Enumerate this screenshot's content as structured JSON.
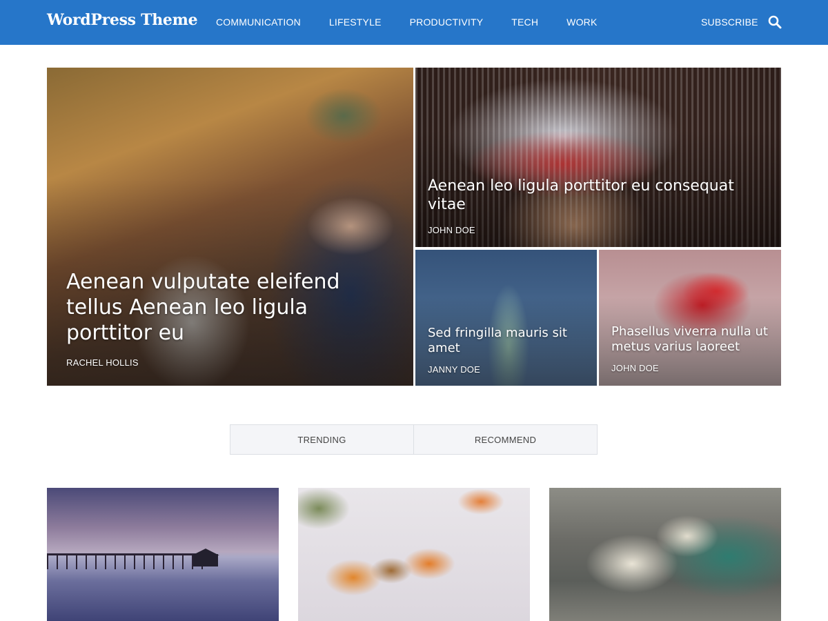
{
  "header": {
    "site_title": "WordPress Theme",
    "nav": [
      "COMMUNICATION",
      "LIFESTYLE",
      "PRODUCTIVITY",
      "TECH",
      "WORK"
    ],
    "subscribe_label": "SUBSCRIBE",
    "search_icon": "search-icon",
    "background_color": "#2676c9"
  },
  "featured": [
    {
      "title": "Aenean vulputate eleifend tellus Aenean leo ligula porttitor eu",
      "author": "RACHEL HOLLIS"
    },
    {
      "title": "Aenean leo ligula porttitor eu consequat vitae",
      "author": "JOHN DOE"
    },
    {
      "title": "Sed fringilla mauris sit amet",
      "author": "JANNY DOE"
    },
    {
      "title": "Phasellus viverra nulla ut metus varius laoreet",
      "author": "JOHN DOE"
    }
  ],
  "tabs": [
    "TRENDING",
    "RECOMMEND"
  ]
}
